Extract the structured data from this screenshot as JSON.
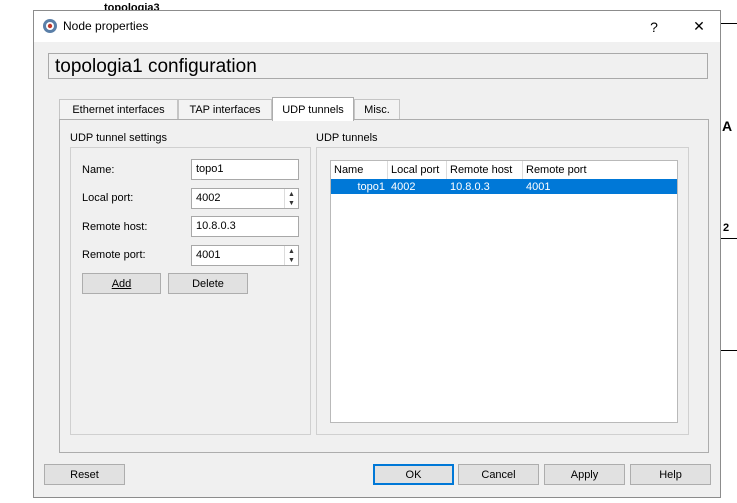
{
  "background": {
    "top_label": "topologia3",
    "right_label_a": "A",
    "right_label_b": "2"
  },
  "window": {
    "title": "Node properties",
    "help_button": "?",
    "close_button": "✕"
  },
  "config_title": "topologia1 configuration",
  "tabs": [
    {
      "label": "Ethernet interfaces"
    },
    {
      "label": "TAP interfaces"
    },
    {
      "label": "UDP tunnels"
    },
    {
      "label": "Misc."
    }
  ],
  "settings": {
    "group_title": "UDP tunnel settings",
    "name_label": "Name:",
    "name_value": "topo1",
    "local_port_label": "Local port:",
    "local_port_value": "4002",
    "remote_host_label": "Remote host:",
    "remote_host_value": "10.8.0.3",
    "remote_port_label": "Remote port:",
    "remote_port_value": "4001",
    "add_button": "Add",
    "delete_button": "Delete"
  },
  "tunnels": {
    "group_title": "UDP tunnels",
    "columns": [
      "Name",
      "Local port",
      "Remote host",
      "Remote port"
    ],
    "rows": [
      {
        "name": "topo1",
        "local_port": "4002",
        "remote_host": "10.8.0.3",
        "remote_port": "4001"
      }
    ]
  },
  "footer": {
    "reset": "Reset",
    "ok": "OK",
    "cancel": "Cancel",
    "apply": "Apply",
    "help": "Help"
  },
  "colors": {
    "selection": "#0078d7",
    "dialog_bg": "#f0f0f0"
  }
}
